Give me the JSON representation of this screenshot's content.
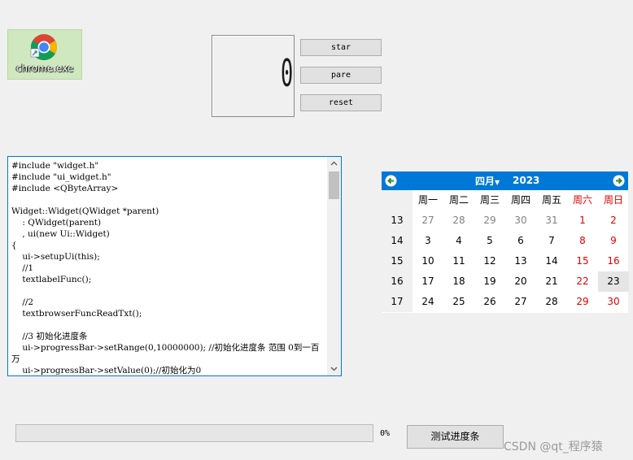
{
  "desktop_icon": {
    "label": "chrome.exe",
    "icon": "chrome-icon"
  },
  "lcd": {
    "value": "0"
  },
  "buttons": {
    "start": "star",
    "pause": "pare",
    "reset": "reset",
    "test_progress": "测试进度条"
  },
  "text_browser": {
    "lines": [
      "#include \"widget.h\"",
      "#include \"ui_widget.h\"",
      "#include <QByteArray>",
      "",
      "Widget::Widget(QWidget *parent)",
      "    : QWidget(parent)",
      "    , ui(new Ui::Widget)",
      "{",
      "    ui->setupUi(this);",
      "    //1",
      "    textlabelFunc();",
      "",
      "    //2",
      "    textbrowserFuncReadTxt();",
      "",
      "    //3 初始化进度条",
      "    ui->progressBar->setRange(0,10000000); //初始化进度条 范围 0到一百万",
      "    ui->progressBar->setValue(0);//初始化为0"
    ]
  },
  "calendar": {
    "month": "四月",
    "year": "2023",
    "weekday_headers": [
      "周一",
      "周二",
      "周三",
      "周四",
      "周五",
      "周六",
      "周日"
    ],
    "weeks": [
      {
        "week": "13",
        "days": [
          "27",
          "28",
          "29",
          "30",
          "31",
          "1",
          "2"
        ]
      },
      {
        "week": "14",
        "days": [
          "3",
          "4",
          "5",
          "6",
          "7",
          "8",
          "9"
        ]
      },
      {
        "week": "15",
        "days": [
          "10",
          "11",
          "12",
          "13",
          "14",
          "15",
          "16"
        ]
      },
      {
        "week": "16",
        "days": [
          "17",
          "18",
          "19",
          "20",
          "21",
          "22",
          "23"
        ]
      },
      {
        "week": "17",
        "days": [
          "24",
          "25",
          "26",
          "27",
          "28",
          "29",
          "30"
        ]
      }
    ],
    "selected_date": "23",
    "header_color": "#0078d7",
    "weekend_color": "#e00000"
  },
  "progress": {
    "percent_text": "0%",
    "value": 0
  },
  "watermark": "CSDN @qt_程序猿"
}
